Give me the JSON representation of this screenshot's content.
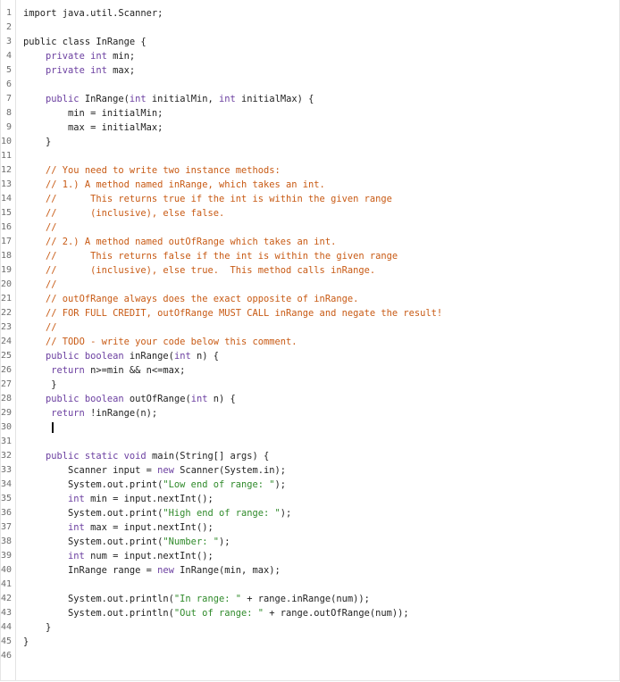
{
  "editor": {
    "language": "java",
    "cursor_line": 30,
    "colors": {
      "keyword": "#6b3fa0",
      "comment": "#c85a14",
      "string": "#2f8a2a",
      "text": "#1f1f1f"
    },
    "lines": [
      [
        [
          "tx",
          "import java.util.Scanner;"
        ]
      ],
      [],
      [
        [
          "tx",
          "public class InRange {"
        ]
      ],
      [
        [
          "tx",
          "    "
        ],
        [
          "kw",
          "private"
        ],
        [
          "tx",
          " "
        ],
        [
          "kw",
          "int"
        ],
        [
          "tx",
          " min;"
        ]
      ],
      [
        [
          "tx",
          "    "
        ],
        [
          "kw",
          "private"
        ],
        [
          "tx",
          " "
        ],
        [
          "kw",
          "int"
        ],
        [
          "tx",
          " max;"
        ]
      ],
      [],
      [
        [
          "tx",
          "    "
        ],
        [
          "kw",
          "public"
        ],
        [
          "tx",
          " InRange("
        ],
        [
          "kw",
          "int"
        ],
        [
          "tx",
          " initialMin, "
        ],
        [
          "kw",
          "int"
        ],
        [
          "tx",
          " initialMax) {"
        ]
      ],
      [
        [
          "tx",
          "        min = initialMin;"
        ]
      ],
      [
        [
          "tx",
          "        max = initialMax;"
        ]
      ],
      [
        [
          "tx",
          "    }"
        ]
      ],
      [],
      [
        [
          "tx",
          "    "
        ],
        [
          "cm",
          "// You need to write two instance methods:"
        ]
      ],
      [
        [
          "tx",
          "    "
        ],
        [
          "cm",
          "// 1.) A method named inRange, which takes an int."
        ]
      ],
      [
        [
          "tx",
          "    "
        ],
        [
          "cm",
          "//      This returns true if the int is within the given range"
        ]
      ],
      [
        [
          "tx",
          "    "
        ],
        [
          "cm",
          "//      (inclusive), else false."
        ]
      ],
      [
        [
          "tx",
          "    "
        ],
        [
          "cm",
          "//"
        ]
      ],
      [
        [
          "tx",
          "    "
        ],
        [
          "cm",
          "// 2.) A method named outOfRange which takes an int."
        ]
      ],
      [
        [
          "tx",
          "    "
        ],
        [
          "cm",
          "//      This returns false if the int is within the given range"
        ]
      ],
      [
        [
          "tx",
          "    "
        ],
        [
          "cm",
          "//      (inclusive), else true.  This method calls inRange."
        ]
      ],
      [
        [
          "tx",
          "    "
        ],
        [
          "cm",
          "//"
        ]
      ],
      [
        [
          "tx",
          "    "
        ],
        [
          "cm",
          "// outOfRange always does the exact opposite of inRange."
        ]
      ],
      [
        [
          "tx",
          "    "
        ],
        [
          "cm",
          "// FOR FULL CREDIT, outOfRange MUST CALL inRange and negate the result!"
        ]
      ],
      [
        [
          "tx",
          "    "
        ],
        [
          "cm",
          "//"
        ]
      ],
      [
        [
          "tx",
          "    "
        ],
        [
          "cm",
          "// TODO - write your code below this comment."
        ]
      ],
      [
        [
          "tx",
          "    "
        ],
        [
          "kw",
          "public"
        ],
        [
          "tx",
          " "
        ],
        [
          "kw",
          "boolean"
        ],
        [
          "tx",
          " inRange("
        ],
        [
          "kw",
          "int"
        ],
        [
          "tx",
          " n) {"
        ]
      ],
      [
        [
          "tx",
          "     "
        ],
        [
          "kw",
          "return"
        ],
        [
          "tx",
          " n>=min && n<=max;"
        ]
      ],
      [
        [
          "tx",
          "     }"
        ]
      ],
      [
        [
          "tx",
          "    "
        ],
        [
          "kw",
          "public"
        ],
        [
          "tx",
          " "
        ],
        [
          "kw",
          "boolean"
        ],
        [
          "tx",
          " outOfRange("
        ],
        [
          "kw",
          "int"
        ],
        [
          "tx",
          " n) {"
        ]
      ],
      [
        [
          "tx",
          "     "
        ],
        [
          "kw",
          "return"
        ],
        [
          "tx",
          " !inRange(n);"
        ]
      ],
      [
        [
          "tx",
          "     "
        ]
      ],
      [],
      [
        [
          "tx",
          "    "
        ],
        [
          "kw",
          "public"
        ],
        [
          "tx",
          " "
        ],
        [
          "kw",
          "static"
        ],
        [
          "tx",
          " "
        ],
        [
          "kw",
          "void"
        ],
        [
          "tx",
          " main(String[] args) {"
        ]
      ],
      [
        [
          "tx",
          "        Scanner input = "
        ],
        [
          "kw",
          "new"
        ],
        [
          "tx",
          " Scanner(System.in);"
        ]
      ],
      [
        [
          "tx",
          "        System.out.print("
        ],
        [
          "str",
          "\"Low end of range: \""
        ],
        [
          "tx",
          ");"
        ]
      ],
      [
        [
          "tx",
          "        "
        ],
        [
          "kw",
          "int"
        ],
        [
          "tx",
          " min = input.nextInt();"
        ]
      ],
      [
        [
          "tx",
          "        System.out.print("
        ],
        [
          "str",
          "\"High end of range: \""
        ],
        [
          "tx",
          ");"
        ]
      ],
      [
        [
          "tx",
          "        "
        ],
        [
          "kw",
          "int"
        ],
        [
          "tx",
          " max = input.nextInt();"
        ]
      ],
      [
        [
          "tx",
          "        System.out.print("
        ],
        [
          "str",
          "\"Number: \""
        ],
        [
          "tx",
          ");"
        ]
      ],
      [
        [
          "tx",
          "        "
        ],
        [
          "kw",
          "int"
        ],
        [
          "tx",
          " num = input.nextInt();"
        ]
      ],
      [
        [
          "tx",
          "        InRange range = "
        ],
        [
          "kw",
          "new"
        ],
        [
          "tx",
          " InRange(min, max);"
        ]
      ],
      [],
      [
        [
          "tx",
          "        System.out.println("
        ],
        [
          "str",
          "\"In range: \""
        ],
        [
          "tx",
          " + range.inRange(num));"
        ]
      ],
      [
        [
          "tx",
          "        System.out.println("
        ],
        [
          "str",
          "\"Out of range: \""
        ],
        [
          "tx",
          " + range.outOfRange(num));"
        ]
      ],
      [
        [
          "tx",
          "    }"
        ]
      ],
      [
        [
          "tx",
          "}"
        ]
      ],
      []
    ]
  }
}
